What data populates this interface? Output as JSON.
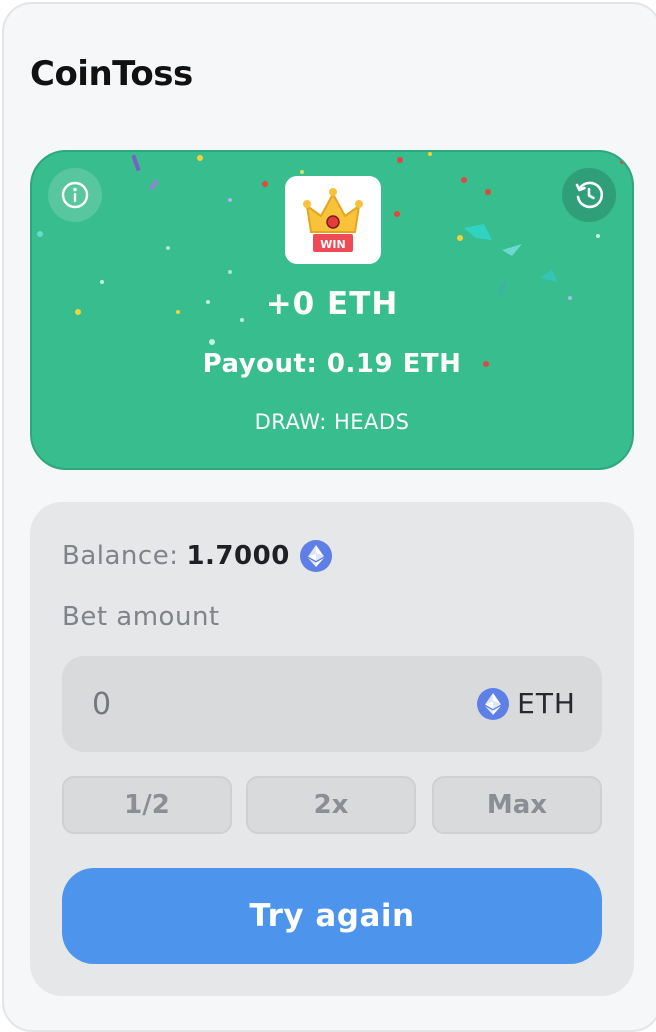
{
  "app": {
    "title": "CoinToss"
  },
  "result": {
    "profit": "+0 ETH",
    "payout": "Payout: 0.19 ETH",
    "draw": "DRAW: HEADS",
    "badge_text": "WIN",
    "icons": {
      "info": "info-icon",
      "history": "history-icon",
      "badge": "crown-icon"
    }
  },
  "wallet": {
    "balance_label": "Balance:",
    "balance_value": "1.7000",
    "currency_icon": "ethereum-icon"
  },
  "bet": {
    "label": "Bet amount",
    "placeholder": "0",
    "currency": "ETH",
    "quick_buttons": [
      "1/2",
      "2x",
      "Max"
    ],
    "action_label": "Try again"
  },
  "colors": {
    "card": "#38bd8e",
    "action": "#4d94ec",
    "eth": "#5d7fe6"
  }
}
